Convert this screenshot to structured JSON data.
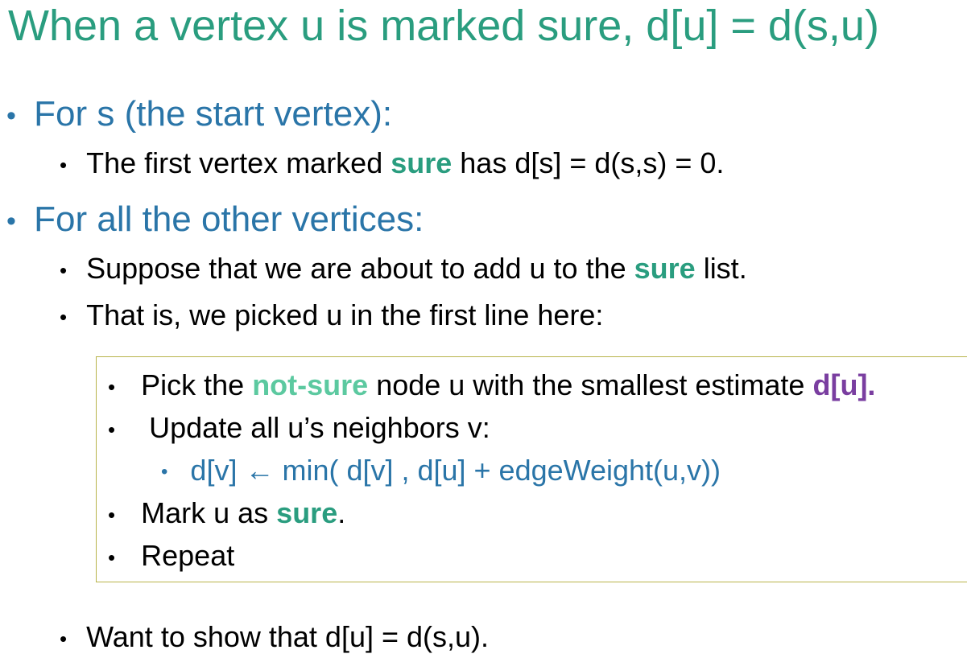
{
  "title": "When a vertex u is marked sure, d[u] = d(s,u)",
  "bullet_char": "•",
  "section1": {
    "heading": "For s (the start vertex):",
    "item1": {
      "pre": "The first vertex marked ",
      "highlight": "sure",
      "post": " has d[s] = d(s,s) = 0."
    }
  },
  "section2": {
    "heading": "For all the other vertices:",
    "item1": {
      "pre": "Suppose that we are about to add u to the ",
      "highlight": "sure",
      "post": " list."
    },
    "item2": "That is, we picked u in the first line here:"
  },
  "algorithm": {
    "step1": {
      "pre": "Pick the ",
      "highlight": "not-sure",
      "mid": " node u with the smallest estimate ",
      "highlight2": "d[u]."
    },
    "step2": "Update all u’s neighbors v:",
    "step2_sub": "d[v] ← min( d[v] , d[u] + edgeWeight(u,v))",
    "step3": {
      "pre": "Mark u as ",
      "highlight": "sure",
      "post": "."
    },
    "step4": "Repeat"
  },
  "final_item": "Want to show that d[u] = d(s,u).",
  "colors": {
    "title": "#2a9d7f",
    "heading": "#2a75a8",
    "sure": "#2a9d7f",
    "not_sure": "#5cc9a0",
    "estimate": "#7a3ea0",
    "box_border": "#b8b34a"
  }
}
